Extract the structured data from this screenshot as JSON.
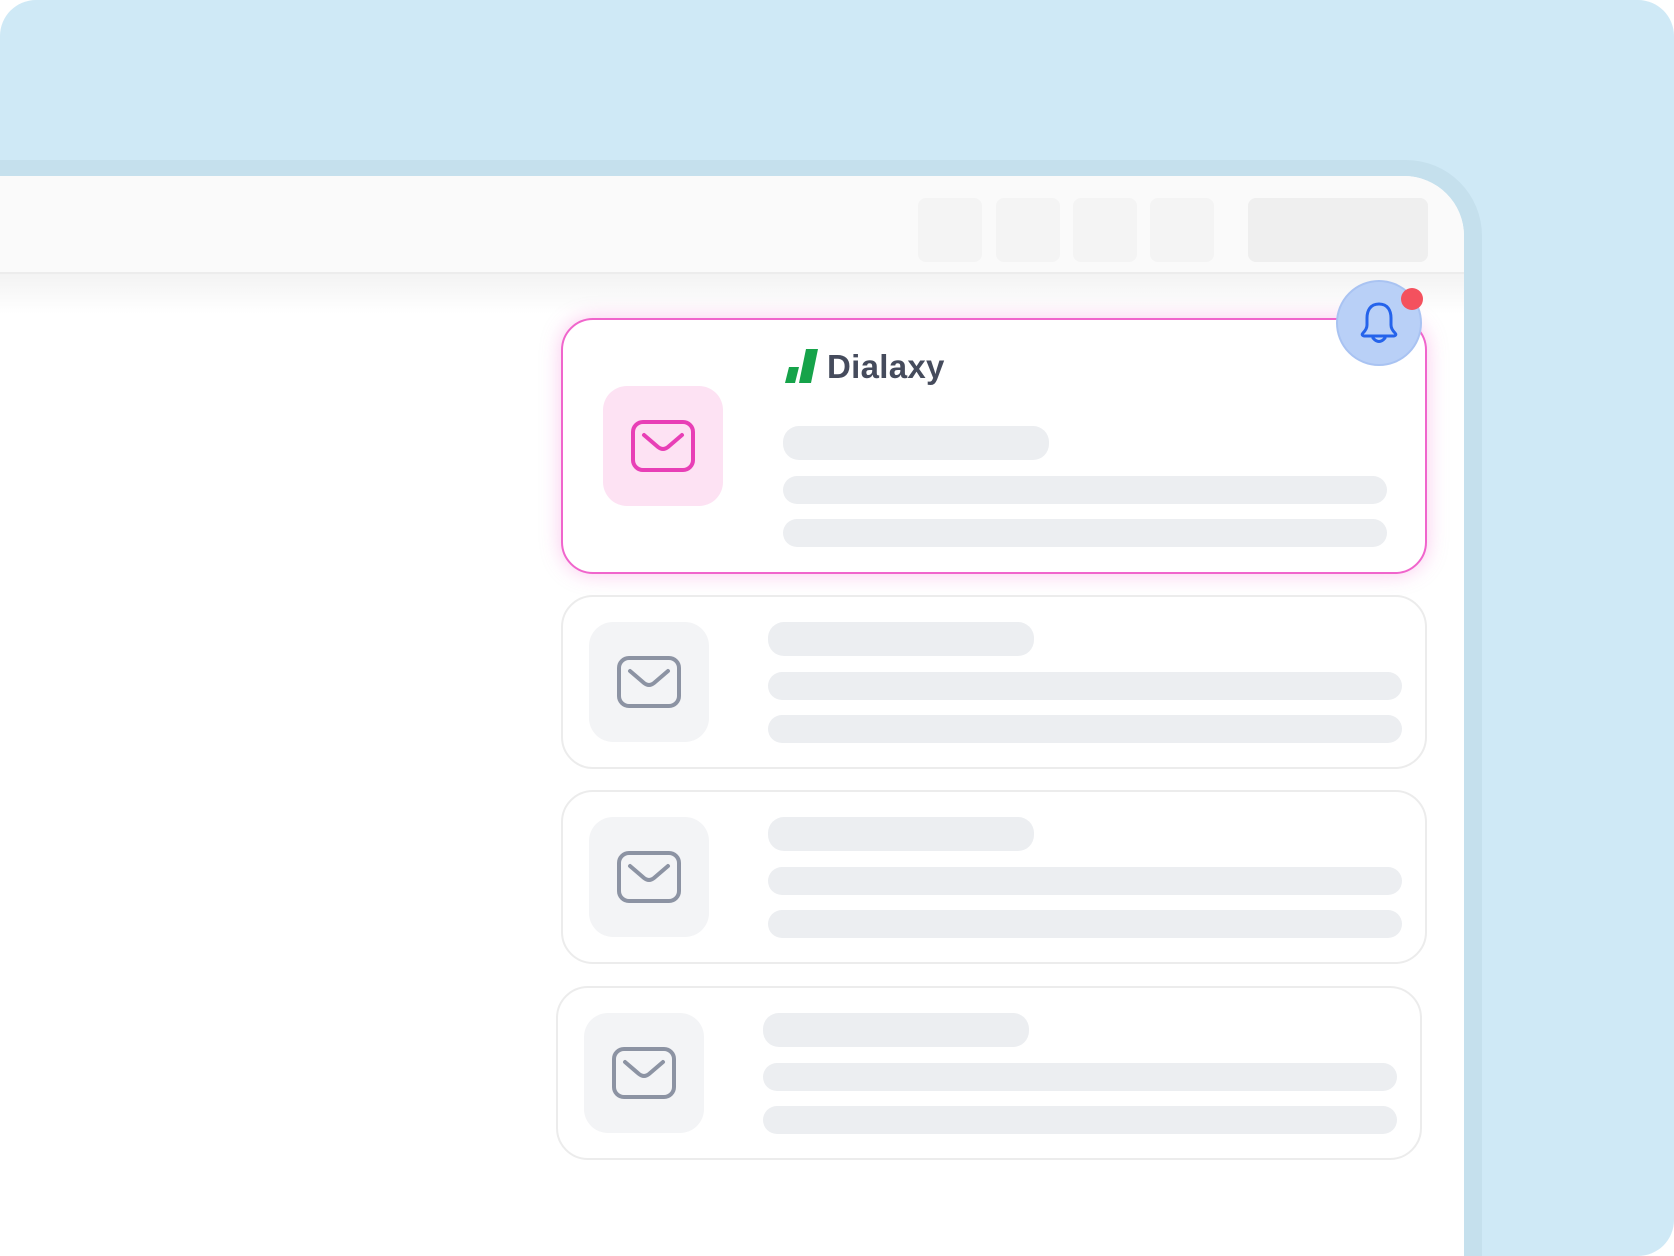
{
  "brand": {
    "name": "Dialaxy",
    "logo_color": "#16a34a"
  },
  "notification": {
    "icon": "bell-icon",
    "has_unread": true,
    "badge_color": "#f4515e"
  },
  "toolbar": {
    "buttons": [
      "toolbar-button",
      "toolbar-button",
      "toolbar-button",
      "toolbar-button"
    ],
    "wide_control": "toolbar-wide-control"
  },
  "cards": [
    {
      "icon": "mail-icon",
      "state": "active",
      "accent": "#f065cc"
    },
    {
      "icon": "mail-icon",
      "state": "default"
    },
    {
      "icon": "mail-icon",
      "state": "default"
    },
    {
      "icon": "mail-icon",
      "state": "default"
    }
  ]
}
